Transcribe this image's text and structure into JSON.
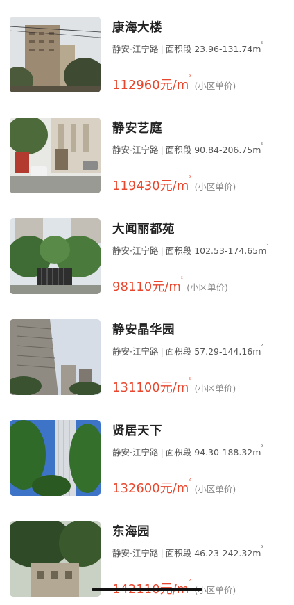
{
  "listings": [
    {
      "name": "康海大楼",
      "district": "静安·江宁路",
      "area_label": "面积段",
      "area_range": "23.96-131.74m",
      "area_unit_sup": "²",
      "price": "112960元/m",
      "price_unit_sup": "²",
      "price_note": "(小区单价)",
      "photo_icon": "tower-building-photo",
      "colors": {
        "sky": "#dfe3e6",
        "building": "#9c8a72",
        "trees": "#3e4a32"
      }
    },
    {
      "name": "静安艺庭",
      "district": "静安·江宁路",
      "area_label": "面积段",
      "area_range": "90.84-206.75m",
      "area_unit_sup": "²",
      "price": "119430元/m",
      "price_unit_sup": "²",
      "price_note": "(小区单价)",
      "photo_icon": "gate-street-photo",
      "colors": {
        "sky": "#e8e8e4",
        "building": "#d9d2c4",
        "trees": "#4d6a3a"
      }
    },
    {
      "name": "大闻丽都苑",
      "district": "静安·江宁路",
      "area_label": "面积段",
      "area_range": "102.53-174.65m",
      "area_unit_sup": "²",
      "price": "98110元/m",
      "price_unit_sup": "²",
      "price_note": "(小区单价)",
      "photo_icon": "gated-garden-photo",
      "colors": {
        "sky": "#dfe4e8",
        "building": "#c4bfb6",
        "trees": "#3f6b34"
      }
    },
    {
      "name": "静安晶华园",
      "district": "静安·江宁路",
      "area_label": "面积段",
      "area_range": "57.29-144.16m",
      "area_unit_sup": "²",
      "price": "131100元/m",
      "price_unit_sup": "²",
      "price_note": "(小区单价)",
      "photo_icon": "highrise-photo",
      "colors": {
        "sky": "#d6dde6",
        "building": "#8f8a82",
        "trees": "#3b5230"
      }
    },
    {
      "name": "贤居天下",
      "district": "静安·江宁路",
      "area_label": "面积段",
      "area_range": "94.30-188.32m",
      "area_unit_sup": "²",
      "price": "132600元/m",
      "price_unit_sup": "²",
      "price_note": "(小区单价)",
      "photo_icon": "tree-lined-tower-photo",
      "colors": {
        "sky": "#3e74c8",
        "building": "#d8dbe0",
        "trees": "#2f6a28"
      }
    },
    {
      "name": "东海园",
      "district": "静安·江宁路",
      "area_label": "面积段",
      "area_range": "46.23-242.32m",
      "area_unit_sup": "²",
      "price": "142110元/m",
      "price_unit_sup": "²",
      "price_note": "(小区单价)",
      "photo_icon": "courtyard-photo",
      "colors": {
        "sky": "#c9d0c4",
        "building": "#b2a894",
        "trees": "#2f4a27"
      }
    }
  ]
}
